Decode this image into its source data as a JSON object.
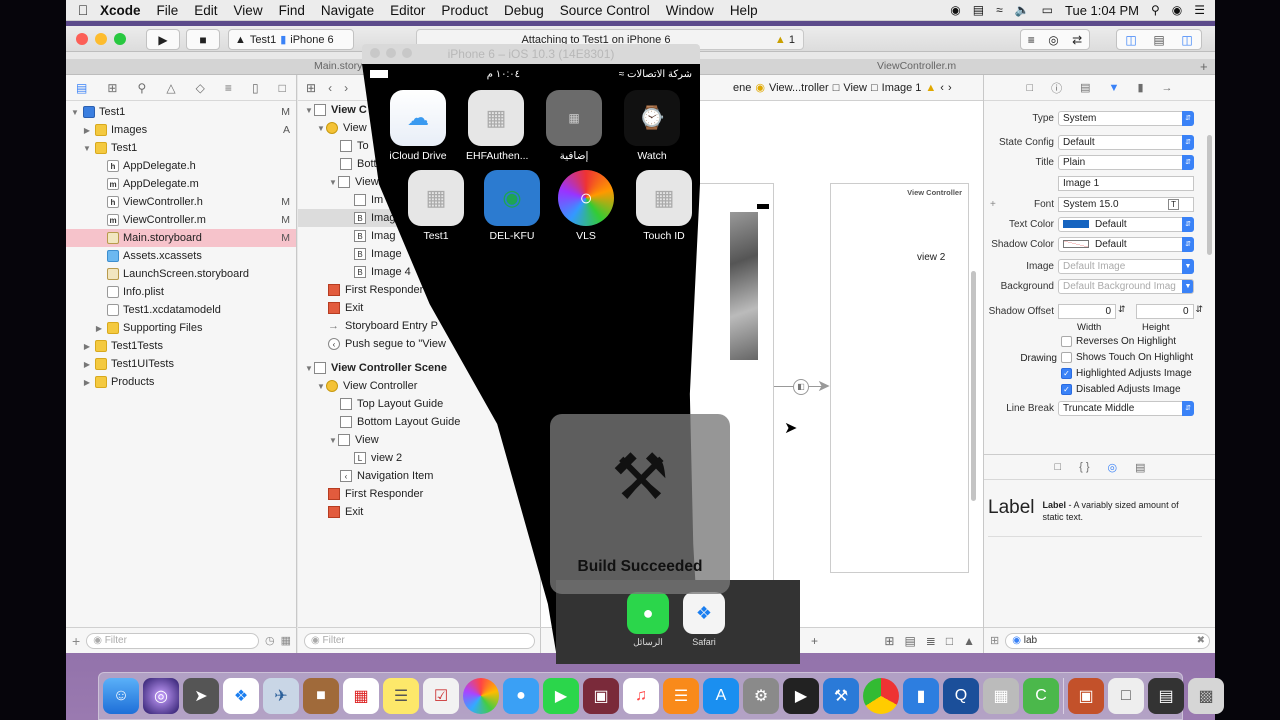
{
  "menubar": {
    "app_name": "Xcode",
    "menus": [
      "File",
      "Edit",
      "View",
      "Find",
      "Navigate",
      "Editor",
      "Product",
      "Debug",
      "Source Control",
      "Window",
      "Help"
    ],
    "clock": "Tue 1:04 PM"
  },
  "toolbar": {
    "scheme_target": "Test1",
    "scheme_device": "iPhone 6",
    "activity_text": "Attaching to Test1 on iPhone 6",
    "warning_count": "1"
  },
  "tabs": {
    "left": "Main.story",
    "right": "ViewController.m"
  },
  "navigator": {
    "items": [
      {
        "label": "Test1",
        "status": "M"
      },
      {
        "label": "Images",
        "status": "A"
      },
      {
        "label": "Test1",
        "status": ""
      },
      {
        "label": "AppDelegate.h",
        "status": ""
      },
      {
        "label": "AppDelegate.m",
        "status": ""
      },
      {
        "label": "ViewController.h",
        "status": "M"
      },
      {
        "label": "ViewController.m",
        "status": "M"
      },
      {
        "label": "Main.storyboard",
        "status": "M"
      },
      {
        "label": "Assets.xcassets",
        "status": ""
      },
      {
        "label": "LaunchScreen.storyboard",
        "status": ""
      },
      {
        "label": "Info.plist",
        "status": ""
      },
      {
        "label": "Test1.xcdatamodeld",
        "status": ""
      },
      {
        "label": "Supporting Files",
        "status": ""
      },
      {
        "label": "Test1Tests",
        "status": ""
      },
      {
        "label": "Test1UITests",
        "status": ""
      },
      {
        "label": "Products",
        "status": ""
      }
    ],
    "filter_placeholder": "Filter"
  },
  "outline": {
    "scene1_items": [
      "View C",
      "View",
      "To",
      "Bott",
      "View",
      "Im",
      "Imag",
      "Imag",
      "Image",
      "Image 4",
      "First Responder",
      "Exit",
      "Storyboard Entry P",
      "Push segue to \"View"
    ],
    "scene2_title": "View Controller Scene",
    "scene2_items": [
      "View Controller",
      "Top Layout Guide",
      "Bottom Layout Guide",
      "View",
      "view 2",
      "Navigation Item",
      "First Responder",
      "Exit"
    ],
    "filter_placeholder": "Filter"
  },
  "jumpbar": {
    "items": [
      "ene",
      "View...troller",
      "View",
      "Image 1"
    ]
  },
  "canvas": {
    "vc2_title": "View Controller",
    "vc2_label": "view 2"
  },
  "inspector": {
    "type": {
      "label": "Type",
      "value": "System"
    },
    "state_config": {
      "label": "State Config",
      "value": "Default"
    },
    "title": {
      "label": "Title",
      "value": "Plain"
    },
    "title_text": "Image 1",
    "font": {
      "label": "Font",
      "value": "System 15.0"
    },
    "text_color": {
      "label": "Text Color",
      "value": "Default"
    },
    "shadow_color": {
      "label": "Shadow Color",
      "value": "Default"
    },
    "image": {
      "label": "Image",
      "value": "Default Image"
    },
    "background": {
      "label": "Background",
      "value": "Default Background Imag"
    },
    "shadow_offset": {
      "label": "Shadow Offset",
      "width": "0",
      "height": "0",
      "width_label": "Width",
      "height_label": "Height"
    },
    "checks": [
      {
        "label": "Reverses On Highlight",
        "checked": false
      },
      {
        "label": "Shows Touch On Highlight",
        "checked": false
      },
      {
        "label": "Highlighted Adjusts Image",
        "checked": true
      },
      {
        "label": "Disabled Adjusts Image",
        "checked": true
      }
    ],
    "drawing_label": "Drawing",
    "line_break": {
      "label": "Line Break",
      "value": "Truncate Middle"
    },
    "library_item": {
      "title": "Label",
      "name": "Label",
      "desc": " - A variably sized amount of static text."
    },
    "filter_value": "lab"
  },
  "simulator": {
    "title": "iPhone 6 – iOS 10.3 (14E8301)",
    "carrier": "شركة الاتصالات",
    "time": "١٠:٠٤ م",
    "apps": [
      "iCloud Drive",
      "EHFAuthen...",
      "إضافية",
      "Watch",
      "Test1",
      "DEL-KFU",
      "VLS",
      "Touch ID"
    ],
    "dock_apps": [
      "الرسائل",
      "Safari"
    ],
    "hud_text": "Build Succeeded"
  }
}
